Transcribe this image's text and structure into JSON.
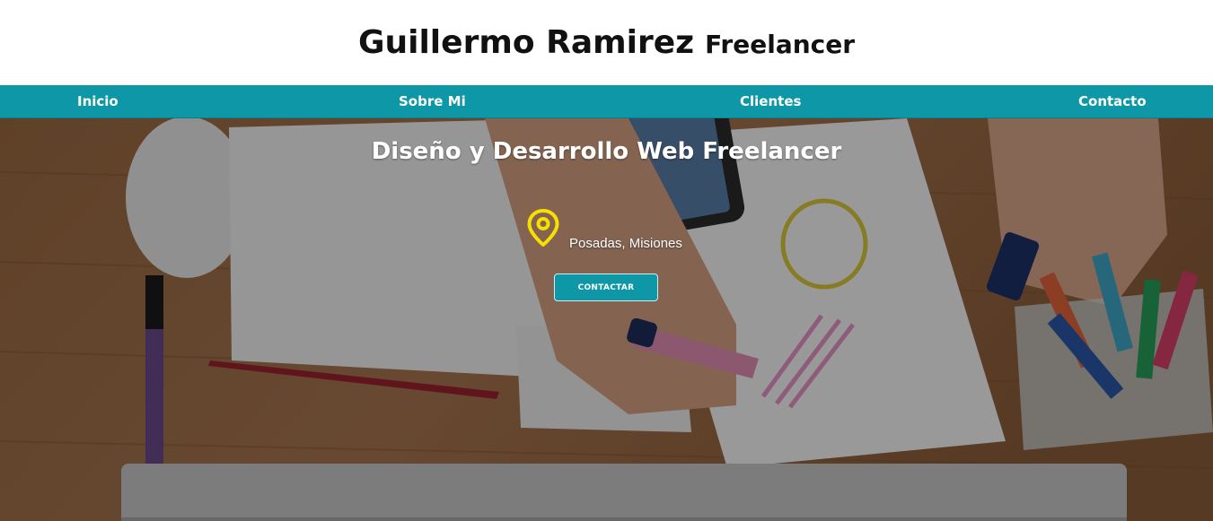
{
  "header": {
    "name": "Guillermo Ramirez",
    "role": "Freelancer"
  },
  "nav": {
    "items": [
      {
        "label": "Inicio"
      },
      {
        "label": "Sobre Mi"
      },
      {
        "label": "Clientes"
      },
      {
        "label": "Contacto"
      }
    ]
  },
  "hero": {
    "heading": "Diseño y Desarrollo Web Freelancer",
    "location": "Posadas, Misiones",
    "location_icon": "map-pin-icon",
    "cta_label": "CONTACTAR"
  },
  "colors": {
    "brand": "#0e97a6",
    "pin": "#f5e000",
    "header_bg": "#ffffff"
  }
}
